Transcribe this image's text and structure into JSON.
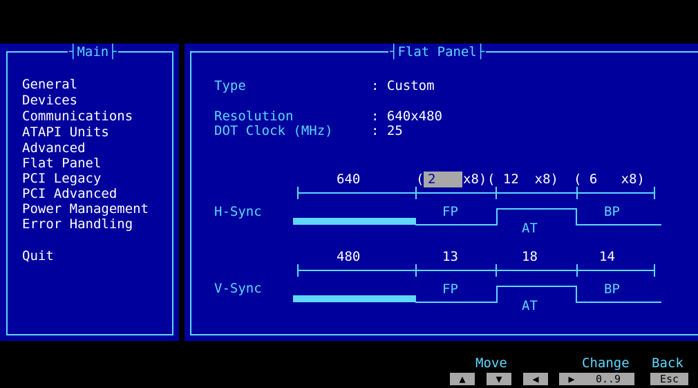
{
  "main_menu": {
    "title": "Main",
    "items": [
      {
        "label": "General"
      },
      {
        "label": "Devices"
      },
      {
        "label": "Communications"
      },
      {
        "label": "ATAPI Units"
      },
      {
        "label": "Advanced"
      },
      {
        "label": "Flat Panel"
      },
      {
        "label": "PCI Legacy"
      },
      {
        "label": "PCI Advanced"
      },
      {
        "label": "Power Management"
      },
      {
        "label": "Error Handling"
      }
    ],
    "quit": "Quit"
  },
  "flat_panel": {
    "title": "Flat Panel",
    "type_label": "Type",
    "type_value": ": Custom",
    "resolution_label": "Resolution",
    "resolution_value": ": 640x480",
    "dot_clock_label": "DOT Clock (MHz)",
    "dot_clock_value": ": 25",
    "hsync": {
      "label": "H-Sync",
      "active": "640",
      "fp_open": "(",
      "fp_value": "2",
      "fp_close": "x8)",
      "at_seg": "( 12  x8)",
      "bp_seg": "( 6   x8)",
      "fp_label": "FP",
      "at_label": "AT",
      "bp_label": "BP"
    },
    "vsync": {
      "label": "V-Sync",
      "active": "480",
      "fp": "13",
      "at": "18",
      "bp": "14",
      "fp_label": "FP",
      "at_label": "AT",
      "bp_label": "BP"
    }
  },
  "footer": {
    "move_label": "Move",
    "change_label": "Change",
    "back_label": "Back",
    "up_key": "▲",
    "down_key": "▼",
    "left_key": "◀",
    "right_key": "▶",
    "change_key": "0..9",
    "back_key": "Esc"
  },
  "colors": {
    "panel_bg": "#00009c",
    "accent": "#5fd7ff",
    "highlight": "#a8a8a8"
  }
}
